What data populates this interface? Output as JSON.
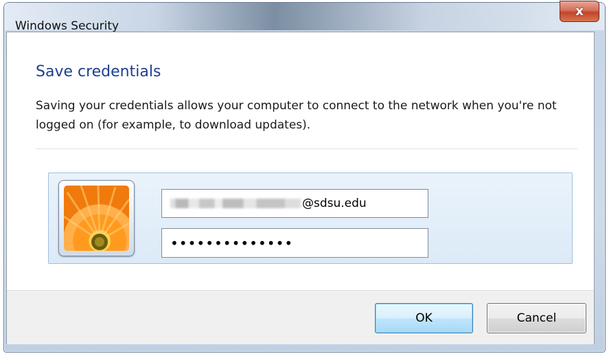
{
  "window": {
    "title": "Windows Security",
    "close_glyph": "x"
  },
  "content": {
    "heading": "Save credentials",
    "description": "Saving your credentials allows your computer to connect to the network when you're not logged on (for example, to download updates)."
  },
  "credentials": {
    "avatar_icon": "flower-user-tile",
    "username_suffix": "@sdsu.edu",
    "password_masked": "••••••••••••••"
  },
  "buttons": {
    "ok_label": "OK",
    "cancel_label": "Cancel"
  },
  "colors": {
    "heading": "#1e3e8e",
    "panel_bg": "#dceaf7",
    "close_red": "#c0452b"
  }
}
